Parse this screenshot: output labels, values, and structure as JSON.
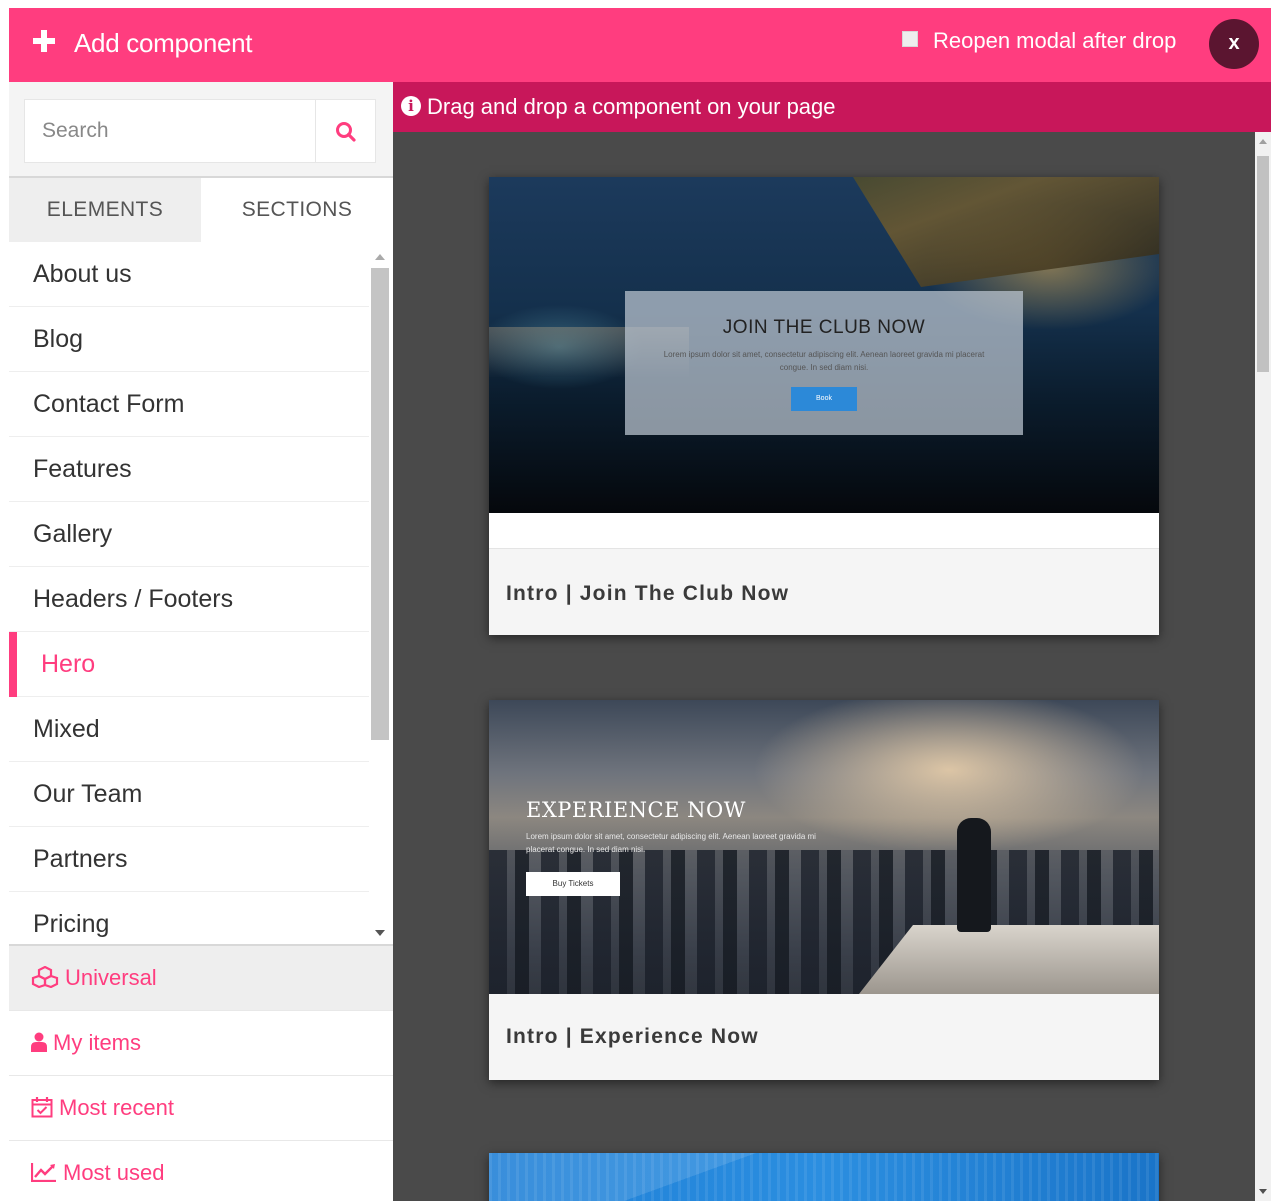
{
  "header": {
    "title": "Add component",
    "reopen_label": "Reopen modal after drop",
    "reopen_checked": false,
    "close_label": "x",
    "accent_color": "#ff3d7f"
  },
  "search": {
    "placeholder": "Search",
    "value": "",
    "icon": "search-icon"
  },
  "tabs": [
    {
      "label": "ELEMENTS",
      "active": true
    },
    {
      "label": "SECTIONS",
      "active": false
    }
  ],
  "categories": [
    {
      "label": "About us"
    },
    {
      "label": "Blog"
    },
    {
      "label": "Contact Form"
    },
    {
      "label": "Features"
    },
    {
      "label": "Gallery"
    },
    {
      "label": "Headers / Footers"
    },
    {
      "label": "Hero",
      "active": true
    },
    {
      "label": "Mixed"
    },
    {
      "label": "Our Team"
    },
    {
      "label": "Partners"
    },
    {
      "label": "Pricing"
    }
  ],
  "quick_links": [
    {
      "label": "Universal",
      "icon": "cubes-icon"
    },
    {
      "label": "My items",
      "icon": "user-icon"
    },
    {
      "label": "Most recent",
      "icon": "calendar-check-icon"
    },
    {
      "label": "Most used",
      "icon": "line-chart-icon"
    }
  ],
  "info_bar": {
    "icon": "info-icon",
    "text": "Drag and drop a component on your page"
  },
  "components": [
    {
      "label": "Intro | Join The Club Now",
      "preview_title": "JOIN THE CLUB NOW",
      "preview_text": "Lorem ipsum dolor sit amet, consectetur adipiscing elit. Aenean laoreet gravida mi placerat congue. In sed diam nisi.",
      "preview_button": "Book"
    },
    {
      "label": "Intro | Experience Now",
      "preview_title": "EXPERIENCE NOW",
      "preview_text": "Lorem ipsum dolor sit amet, consectetur adipiscing elit. Aenean laoreet gravida mi placerat congue. In sed diam nisi.",
      "preview_button": "Buy Tickets"
    }
  ]
}
